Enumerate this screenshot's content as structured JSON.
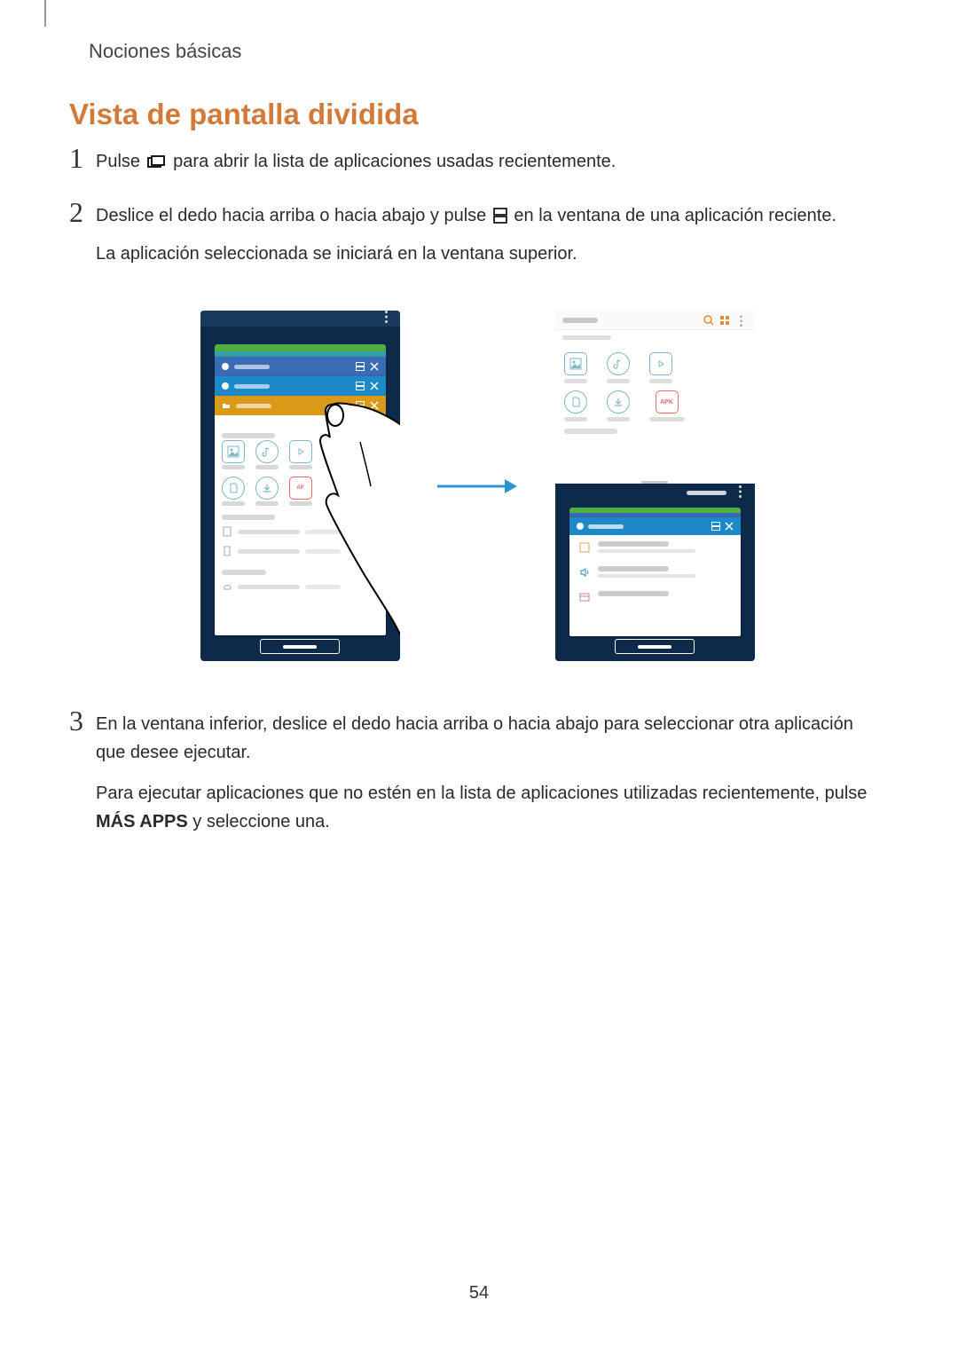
{
  "header": "Nociones básicas",
  "section_title": "Vista de pantalla dividida",
  "step1": {
    "num": "1",
    "a": "Pulse",
    "b": "para abrir la lista de aplicaciones usadas recientemente."
  },
  "step2": {
    "num": "2",
    "a": "Deslice el dedo hacia arriba o hacia abajo y pulse",
    "b": "en la ventana de una aplicación reciente.",
    "c": "La aplicación seleccionada se iniciará en la ventana superior."
  },
  "step3": {
    "num": "3",
    "a": "En la ventana inferior, deslice el dedo hacia arriba o hacia abajo para seleccionar otra aplicación que desee ejecutar.",
    "b1": "Para ejecutar aplicaciones que no estén en la lista de aplicaciones utilizadas recientemente, pulse ",
    "b_bold": "MÁS APPS",
    "b2": " y seleccione una."
  },
  "figure": {
    "apk": "APK"
  },
  "page_number": "54"
}
